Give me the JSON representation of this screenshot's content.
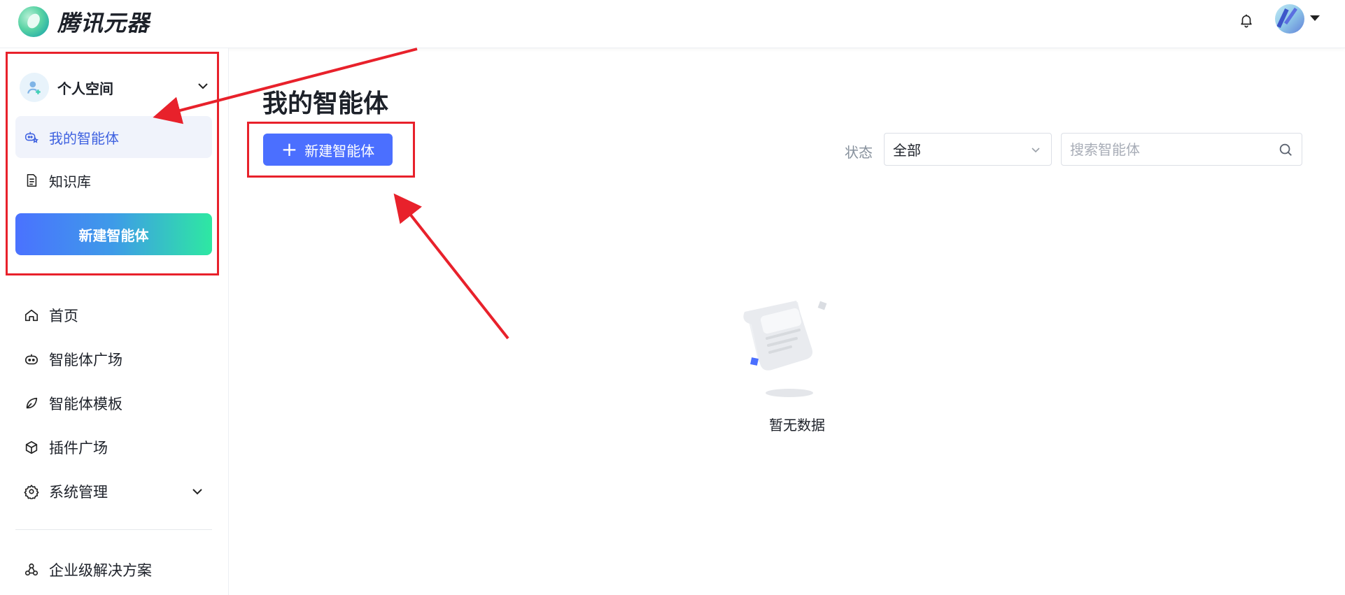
{
  "app": {
    "brand": "腾讯元器"
  },
  "sidebar": {
    "space_label": "个人空间",
    "items": [
      {
        "label": "我的智能体",
        "active": true
      },
      {
        "label": "知识库",
        "active": false
      }
    ],
    "new_agent_button": "新建智能体",
    "menu": [
      {
        "label": "首页",
        "icon": "home-icon"
      },
      {
        "label": "智能体广场",
        "icon": "robot-icon"
      },
      {
        "label": "智能体模板",
        "icon": "leaf-icon"
      },
      {
        "label": "插件广场",
        "icon": "cube-icon"
      },
      {
        "label": "系统管理",
        "icon": "gear-icon",
        "expandable": true
      },
      {
        "label": "企业级解决方案",
        "icon": "triangle-circles-icon"
      }
    ]
  },
  "main": {
    "title": "我的智能体",
    "create_button": "新建智能体",
    "filter": {
      "status_label": "状态",
      "status_value": "全部"
    },
    "search": {
      "placeholder": "搜索智能体",
      "value": ""
    },
    "empty_text": "暂无数据"
  },
  "colors": {
    "primary": "#4b6fff",
    "active_text": "#3f62e0",
    "annotation_red": "#e8212b",
    "gradient_start": "#4a72ff",
    "gradient_end": "#2ee8a2"
  }
}
